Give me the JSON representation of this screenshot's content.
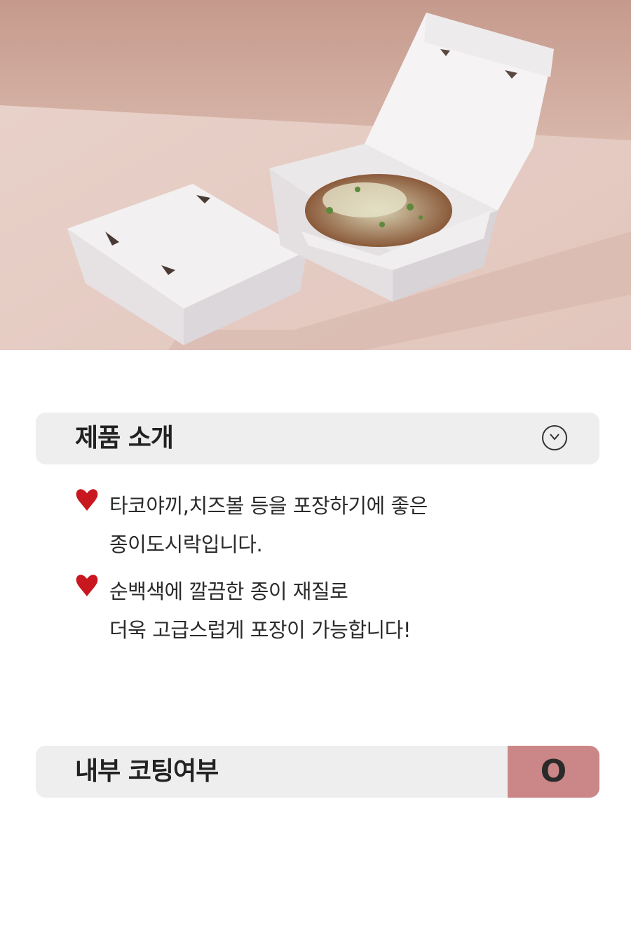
{
  "product_photo": {
    "alt": "",
    "background_colors": [
      "#c9a093",
      "#e4cfc8",
      "#f0dcd6"
    ],
    "box_color": "#f4f2f3"
  },
  "intro_section": {
    "title": "제품 소개",
    "toggle_icon": "chevron-down-circle-icon",
    "features": [
      {
        "icon": "heart-icon",
        "lines": [
          "타코야끼,치즈볼 등을 포장하기에 좋은",
          "종이도시락입니다."
        ]
      },
      {
        "icon": "heart-icon",
        "lines": [
          "순백색에 깔끔한 종이 재질로",
          "더욱 고급스럽게 포장이 가능합니다!"
        ]
      }
    ],
    "heart_color": "#c8171e"
  },
  "coating_section": {
    "title": "내부 코팅여부",
    "value": "O",
    "value_bg": "#cb8788"
  }
}
